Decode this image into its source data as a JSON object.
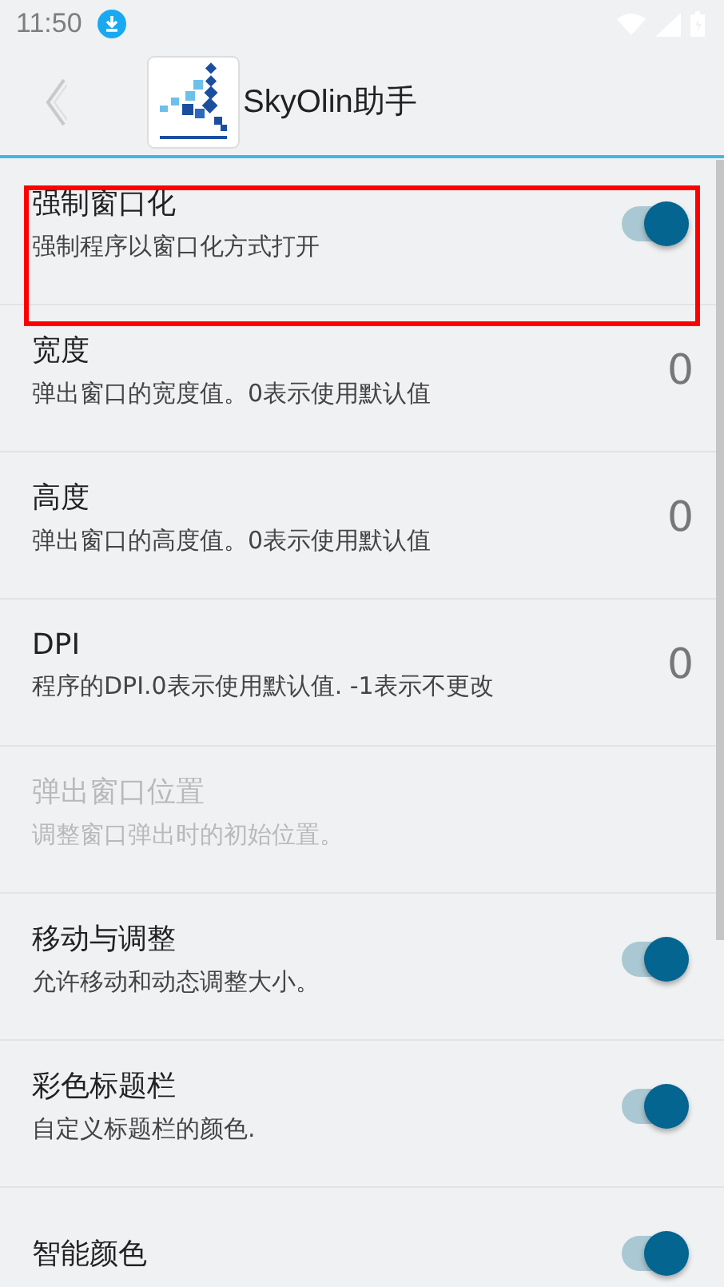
{
  "status_bar": {
    "time": "11:50"
  },
  "header": {
    "title": "SkyOlin助手"
  },
  "settings": [
    {
      "kind": "switch",
      "title": "强制窗口化",
      "summary": "强制程序以窗口化方式打开",
      "on": true,
      "disabled": false,
      "highlighted": true
    },
    {
      "kind": "value",
      "title": "宽度",
      "summary": "弹出窗口的宽度值。0表示使用默认值",
      "value": "0",
      "disabled": false,
      "highlighted": false
    },
    {
      "kind": "value",
      "title": "高度",
      "summary": "弹出窗口的高度值。0表示使用默认值",
      "value": "0",
      "disabled": false,
      "highlighted": false
    },
    {
      "kind": "value",
      "title": "DPI",
      "summary": "程序的DPI.0表示使用默认值. -1表示不更改",
      "value": "0",
      "disabled": false,
      "highlighted": false
    },
    {
      "kind": "plain",
      "title": "弹出窗口位置",
      "summary": "调整窗口弹出时的初始位置。",
      "disabled": true,
      "highlighted": false
    },
    {
      "kind": "switch",
      "title": "移动与调整",
      "summary": "允许移动和动态调整大小。",
      "on": true,
      "disabled": false,
      "highlighted": false
    },
    {
      "kind": "switch",
      "title": "彩色标题栏",
      "summary": "自定义标题栏的颜色.",
      "on": true,
      "disabled": false,
      "highlighted": false
    },
    {
      "kind": "switch",
      "title": "智能颜色",
      "on": true,
      "disabled": false,
      "highlighted": false
    }
  ]
}
